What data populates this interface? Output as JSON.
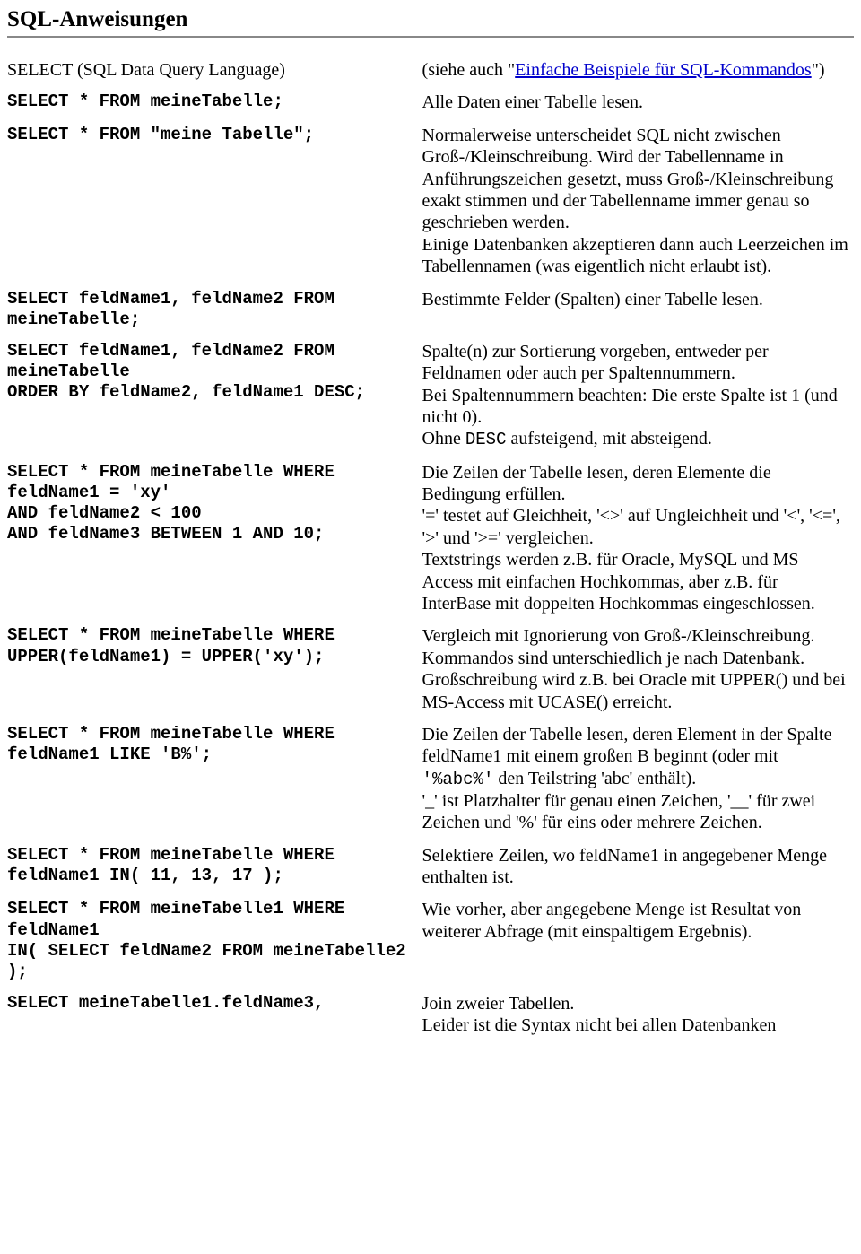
{
  "title": "SQL-Anweisungen",
  "rows": [
    {
      "left": {
        "type": "serif",
        "text": "SELECT (SQL Data Query Language)"
      },
      "right": {
        "type": "mixed",
        "parts": [
          {
            "t": "text",
            "v": "(siehe auch \""
          },
          {
            "t": "link",
            "v": "Einfache Beispiele für SQL-Kommandos"
          },
          {
            "t": "text",
            "v": "\")"
          }
        ]
      }
    },
    {
      "left": {
        "type": "mono",
        "text": "SELECT * FROM meineTabelle;"
      },
      "right": {
        "type": "serif",
        "text": "Alle Daten einer Tabelle lesen."
      }
    },
    {
      "left": {
        "type": "mono",
        "text": "SELECT * FROM \"meine Tabelle\";"
      },
      "right": {
        "type": "serif",
        "text": "Normalerweise unterscheidet SQL nicht zwischen Groß-/Kleinschreibung. Wird der Tabellenname in Anführungszeichen gesetzt, muss Groß-/Kleinschreibung exakt stimmen und der Tabellenname immer genau so geschrieben werden.\nEinige Datenbanken akzeptieren dann auch Leerzeichen im Tabellennamen (was eigentlich nicht erlaubt ist)."
      }
    },
    {
      "left": {
        "type": "mono",
        "text": "SELECT feldName1, feldName2 FROM meineTabelle;"
      },
      "right": {
        "type": "serif",
        "text": "Bestimmte Felder (Spalten) einer Tabelle lesen."
      }
    },
    {
      "left": {
        "type": "mono",
        "text": "SELECT feldName1, feldName2 FROM meineTabelle\nORDER BY feldName2, feldName1 DESC;"
      },
      "right": {
        "type": "mixed",
        "parts": [
          {
            "t": "text",
            "v": "Spalte(n) zur Sortierung vorgeben, entweder per Feldnamen oder auch per Spaltennummern.\nBei Spaltennummern beachten: Die erste Spalte ist 1 (und nicht 0).\nOhne "
          },
          {
            "t": "code",
            "v": "DESC"
          },
          {
            "t": "text",
            "v": " aufsteigend, mit absteigend."
          }
        ]
      }
    },
    {
      "left": {
        "type": "mono",
        "text": "SELECT * FROM meineTabelle WHERE feldName1 = 'xy'\nAND feldName2 < 100\nAND feldName3 BETWEEN 1 AND 10;"
      },
      "right": {
        "type": "serif",
        "text": "Die Zeilen der Tabelle lesen, deren Elemente die Bedingung erfüllen.\n'=' testet auf Gleichheit, '<>' auf Ungleichheit und '<', '<=', '>' und '>=' vergleichen.\nTextstrings werden z.B. für Oracle, MySQL und MS Access mit einfachen Hochkommas, aber z.B. für InterBase mit doppelten Hochkommas eingeschlossen."
      }
    },
    {
      "left": {
        "type": "mono",
        "text": "SELECT * FROM meineTabelle WHERE UPPER(feldName1) = UPPER('xy');"
      },
      "right": {
        "type": "serif",
        "text": "Vergleich mit Ignorierung von Groß-/Kleinschreibung. Kommandos sind unterschiedlich je nach Datenbank. Großschreibung wird z.B. bei Oracle mit UPPER() und bei MS-Access mit UCASE() erreicht."
      }
    },
    {
      "left": {
        "type": "mono",
        "text": "SELECT * FROM meineTabelle WHERE feldName1 LIKE 'B%';"
      },
      "right": {
        "type": "mixed",
        "parts": [
          {
            "t": "text",
            "v": "Die Zeilen der Tabelle lesen, deren Element in der Spalte feldName1 mit einem großen B beginnt (oder mit "
          },
          {
            "t": "code",
            "v": "'%abc%'"
          },
          {
            "t": "text",
            "v": " den Teilstring 'abc' enthält).\n'_' ist Platzhalter für genau einen Zeichen, '__' für zwei Zeichen und '%' für eins oder mehrere Zeichen."
          }
        ]
      }
    },
    {
      "left": {
        "type": "mono",
        "text": "SELECT * FROM meineTabelle WHERE feldName1 IN( 11, 13, 17 );"
      },
      "right": {
        "type": "serif",
        "text": "Selektiere Zeilen, wo feldName1 in angegebener Menge enthalten ist."
      }
    },
    {
      "left": {
        "type": "mono",
        "text": "SELECT * FROM meineTabelle1 WHERE feldName1\nIN( SELECT feldName2 FROM meineTabelle2 );"
      },
      "right": {
        "type": "serif",
        "text": "Wie vorher, aber angegebene Menge ist Resultat von weiterer Abfrage (mit einspaltigem Ergebnis)."
      }
    },
    {
      "left": {
        "type": "mono",
        "text": "SELECT meineTabelle1.feldName3,"
      },
      "right": {
        "type": "serif",
        "text": "Join zweier Tabellen.\nLeider ist die Syntax nicht bei allen Datenbanken"
      }
    }
  ]
}
